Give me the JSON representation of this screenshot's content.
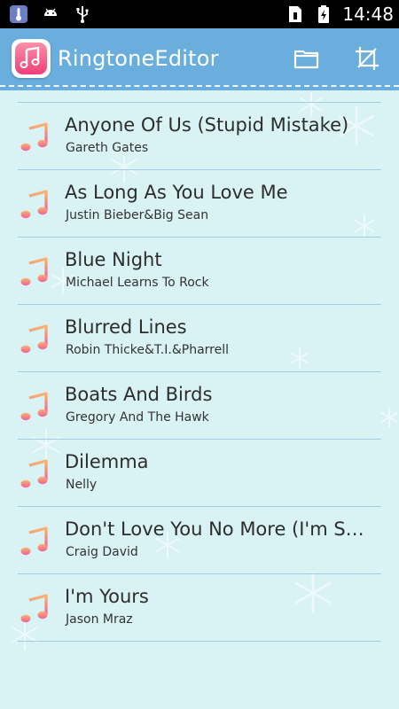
{
  "status_bar": {
    "time": "14:48",
    "left_icons": [
      "thermometer-icon",
      "android-icon",
      "usb-icon"
    ],
    "right_icons": [
      "sim-icon",
      "battery-icon"
    ]
  },
  "app_bar": {
    "title": "RingtoneEditor",
    "actions": [
      "folder-icon",
      "crop-icon"
    ],
    "color": "#6aaede"
  },
  "songs": [
    {
      "title": "Anyone Of Us (Stupid Mistake)",
      "artist": "Gareth Gates"
    },
    {
      "title": "As Long As You Love Me",
      "artist": "Justin Bieber&Big Sean"
    },
    {
      "title": "Blue Night",
      "artist": "Michael Learns To Rock"
    },
    {
      "title": "Blurred Lines",
      "artist": "Robin Thicke&T.I.&Pharrell"
    },
    {
      "title": "Boats And Birds",
      "artist": "Gregory And The Hawk"
    },
    {
      "title": "Dilemma",
      "artist": "Nelly"
    },
    {
      "title": "Don't Love You No More (I'm Sorry)",
      "artist": "Craig David"
    },
    {
      "title": "I'm Yours",
      "artist": "Jason Mraz"
    }
  ],
  "colors": {
    "background": "#d9f2f4",
    "divider": "#9ecbe6",
    "note_gradient_top": "#f9b36a",
    "note_gradient_bottom": "#f0609a"
  }
}
